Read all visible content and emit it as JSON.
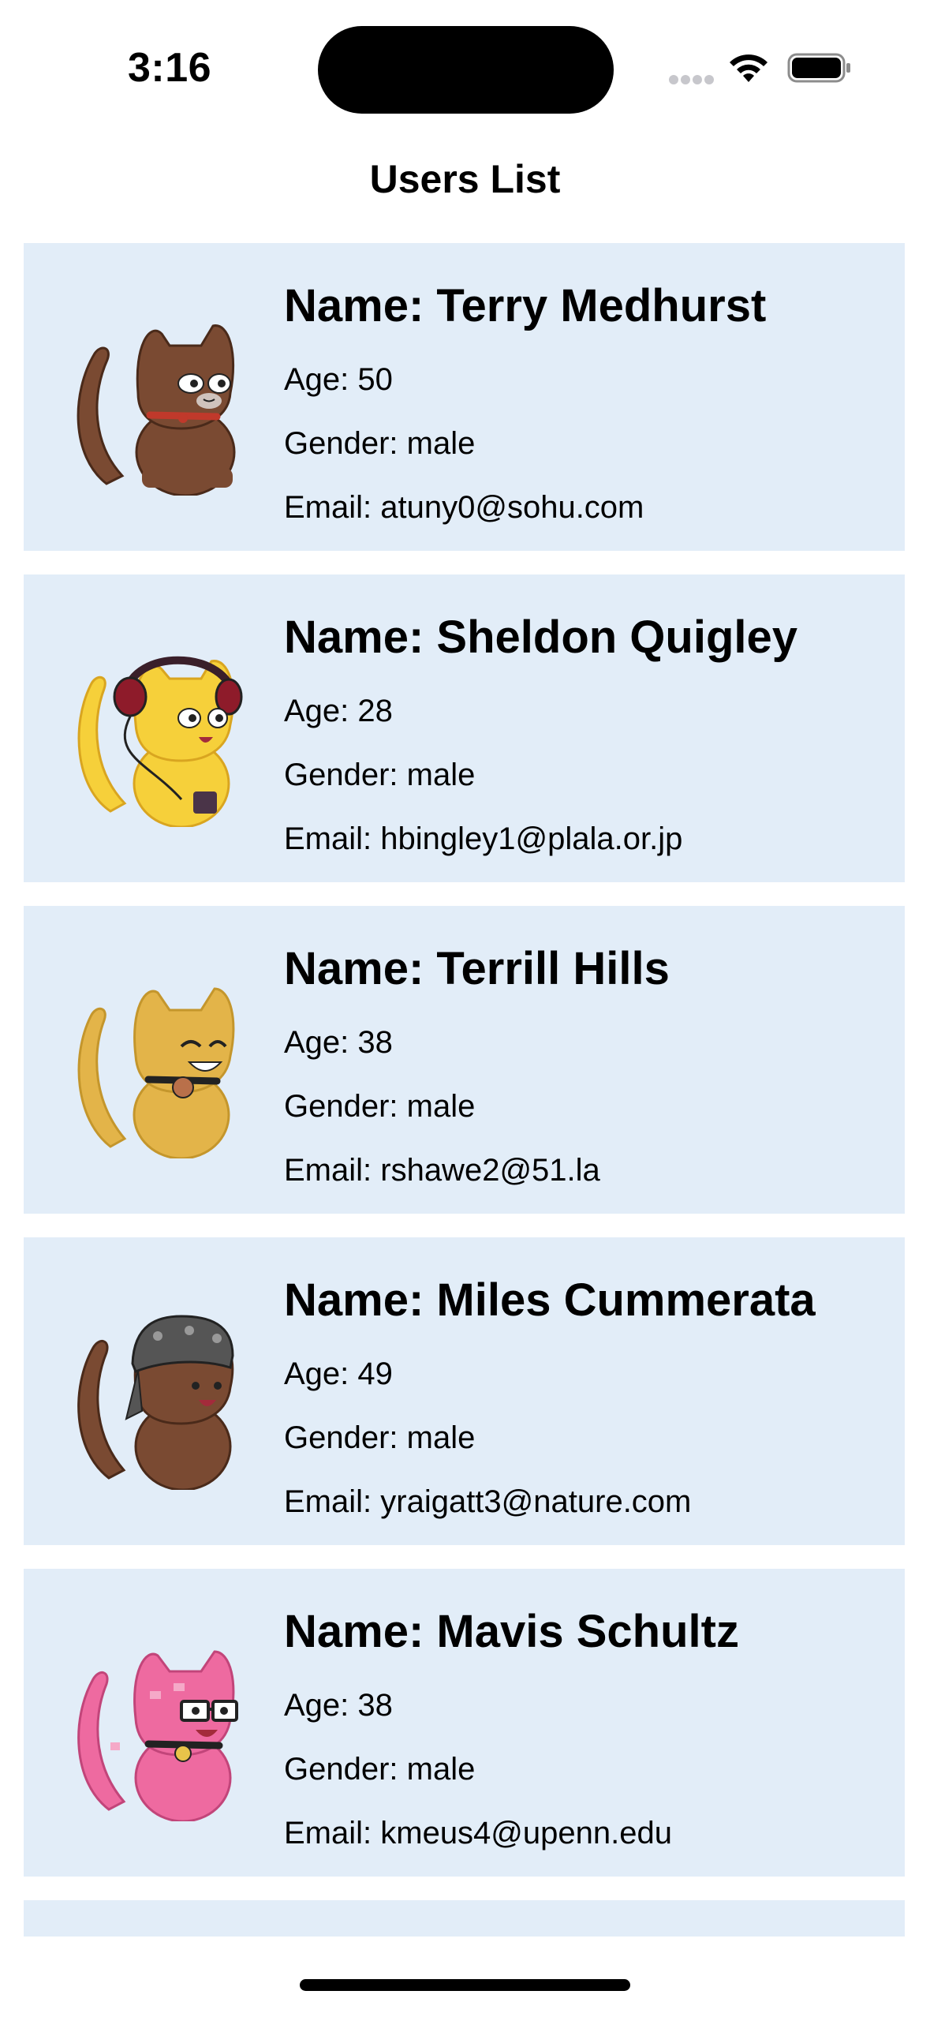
{
  "status_bar": {
    "time": "3:16",
    "icons": [
      "signal-dots-icon",
      "wifi-icon",
      "battery-icon"
    ]
  },
  "header": {
    "title": "Users List"
  },
  "users": [
    {
      "name": "Name: Terry Medhurst",
      "age": "Age: 50",
      "gender": "Gender: male",
      "email": "Email: atuny0@sohu.com",
      "avatar": "brown-cat-red-collar-avatar",
      "colors": {
        "body": "#7a4a32",
        "accent": "#c0392b"
      }
    },
    {
      "name": "Name: Sheldon Quigley",
      "age": "Age: 28",
      "gender": "Gender: male",
      "email": "Email: hbingley1@plala.or.jp",
      "avatar": "yellow-cat-headphones-avatar",
      "colors": {
        "body": "#f6d03a",
        "accent": "#8e1b2a"
      }
    },
    {
      "name": "Name: Terrill Hills",
      "age": "Age: 38",
      "gender": "Gender: male",
      "email": "Email: rshawe2@51.la",
      "avatar": "golden-cat-smiling-avatar",
      "colors": {
        "body": "#e3b449",
        "accent": "#222222"
      }
    },
    {
      "name": "Name: Miles Cummerata",
      "age": "Age: 49",
      "gender": "Gender: male",
      "email": "Email: yraigatt3@nature.com",
      "avatar": "brown-cat-bandana-avatar",
      "colors": {
        "body": "#7a4a32",
        "accent": "#555555"
      }
    },
    {
      "name": "Name: Mavis Schultz",
      "age": "Age: 38",
      "gender": "Gender: male",
      "email": "Email: kmeus4@upenn.edu",
      "avatar": "pink-cat-glasses-avatar",
      "colors": {
        "body": "#ee6aa0",
        "accent": "#222222"
      }
    }
  ],
  "theme": {
    "card_background": "#e2edf8",
    "page_background": "#ffffff"
  }
}
